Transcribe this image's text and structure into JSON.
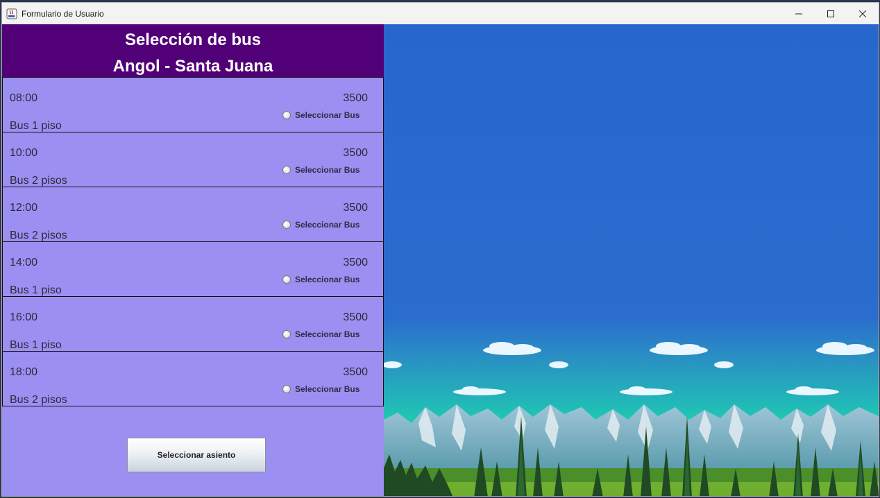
{
  "window": {
    "title": "Formulario de Usuario",
    "icon": "java-app-icon",
    "controls": [
      "minimize-icon",
      "maximize-icon",
      "close-icon"
    ]
  },
  "header": {
    "title": "Selección de bus",
    "route": "Angol - Santa Juana"
  },
  "buses": [
    {
      "time": "08:00",
      "price": "3500",
      "type": "Bus 1 piso",
      "select_label": "Seleccionar Bus"
    },
    {
      "time": "10:00",
      "price": "3500",
      "type": "Bus 2 pisos",
      "select_label": "Seleccionar Bus"
    },
    {
      "time": "12:00",
      "price": "3500",
      "type": "Bus 2 pisos",
      "select_label": "Seleccionar Bus"
    },
    {
      "time": "14:00",
      "price": "3500",
      "type": "Bus 1 piso",
      "select_label": "Seleccionar Bus"
    },
    {
      "time": "16:00",
      "price": "3500",
      "type": "Bus 1 piso",
      "select_label": "Seleccionar Bus"
    },
    {
      "time": "18:00",
      "price": "3500",
      "type": "Bus 2 pisos",
      "select_label": "Seleccionar Bus"
    }
  ],
  "actions": {
    "select_seat_label": "Seleccionar asiento"
  },
  "colors": {
    "header_bg": "#520077",
    "panel_bg": "#9b8ff1",
    "sky": "#2a6bcf"
  }
}
